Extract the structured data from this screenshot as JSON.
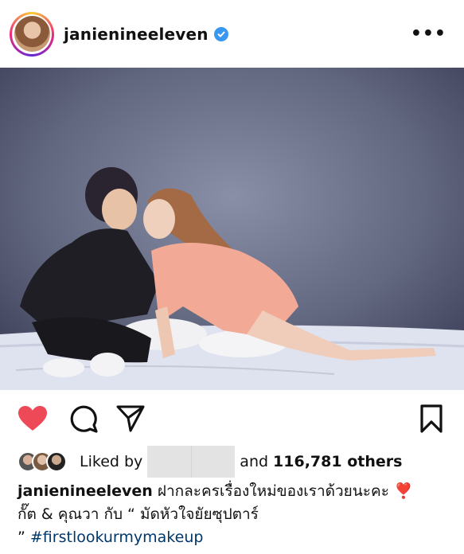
{
  "post": {
    "username": "janienineeleven",
    "liked_by_label": "Liked by",
    "and_label": "and",
    "others_count": "116,781 others",
    "caption_line1": "ฝากละครเรื่องใหม่ของเราด้วยนะคะ ❣️",
    "caption_line2": "กั๊ต & คุณวา กับ “ มัดหัวใจยัยซุปตาร์",
    "caption_line3_prefix": "”",
    "hashtag": "#firstlookurmymakeup"
  },
  "icons": {
    "verified": "verified-badge-icon",
    "more": "more-options-icon",
    "like": "heart-icon",
    "comment": "comment-icon",
    "share": "share-icon",
    "save": "bookmark-icon"
  },
  "colors": {
    "like": "#ed4956",
    "verified": "#3897f0",
    "hashtag": "#00376b"
  }
}
